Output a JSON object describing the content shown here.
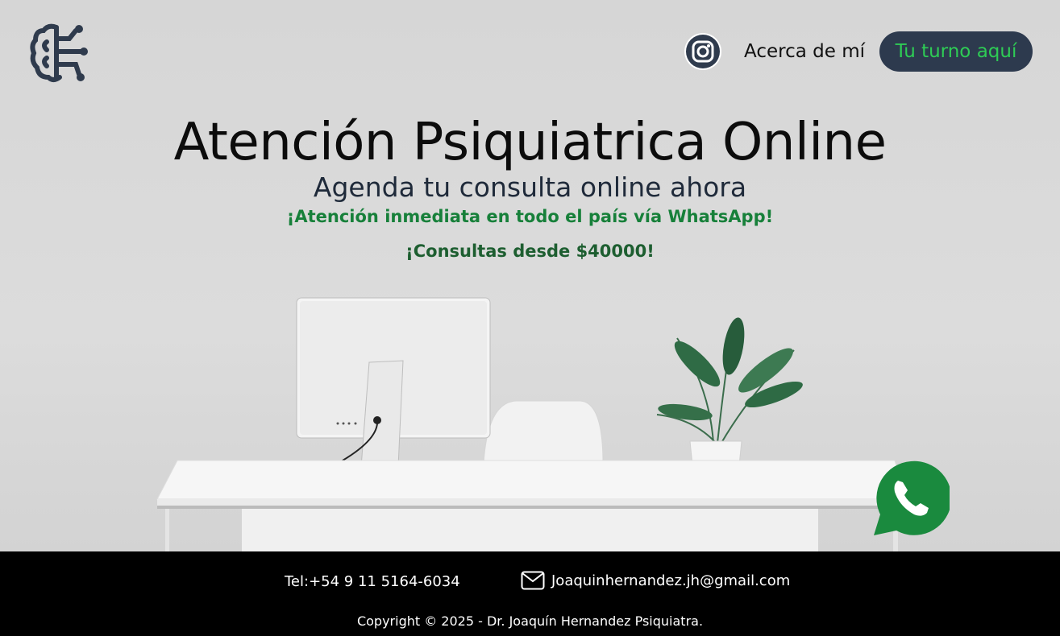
{
  "header": {
    "logo_icon": "brain-circuit-icon",
    "instagram_icon": "instagram-icon",
    "about_label": "Acerca de mí",
    "cta_label": "Tu turno aquí"
  },
  "hero": {
    "title": "Atención Psiquiatrica Online",
    "subtitle": "Agenda tu consulta online ahora",
    "tagline": "¡Atención inmediata en todo el país vía WhatsApp!",
    "price": "¡Consultas desde $40000!"
  },
  "whatsapp": {
    "icon": "whatsapp-icon",
    "color": "#1a8a3e"
  },
  "footer": {
    "phone": "Tel:+54 9 11 5164-6034",
    "email": "Joaquinhernandez.jh@gmail.com",
    "mail_icon": "mail-icon",
    "copyright": "Copyright © 2025 - Dr. Joaquín Hernandez Psiquiatra."
  },
  "colors": {
    "cta_bg": "#2d3a4e",
    "cta_text": "#2ecc55",
    "accent_green": "#17803a"
  }
}
